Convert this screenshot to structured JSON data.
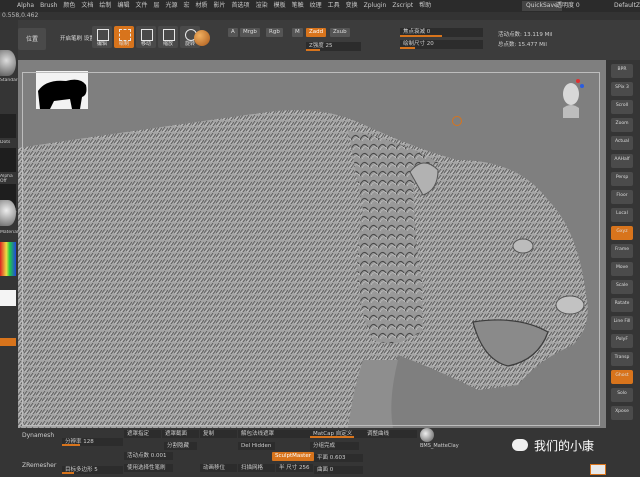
{
  "menu": {
    "items": [
      "Alpha",
      "Brush",
      "颜色",
      "文档",
      "绘制",
      "编辑",
      "文件",
      "层",
      "光源",
      "宏",
      "材质",
      "影片",
      "首选项",
      "渲染",
      "模板",
      "笔触",
      "纹理",
      "工具",
      "变换",
      "Zplugin",
      "Zscript",
      "帮助"
    ],
    "quicksave": "QuickSave",
    "see_through": "透明度 0",
    "default_script": "DefaultZS"
  },
  "title_row": {
    "text": "0.558,0.462"
  },
  "shelf": {
    "left_label": "位置",
    "mode_label": "开启笔刷 设置",
    "tools": [
      {
        "label": "编辑"
      },
      {
        "label": "绘制"
      },
      {
        "label": "移动"
      },
      {
        "label": "缩放"
      },
      {
        "label": "旋转"
      }
    ],
    "channels": {
      "a": "A",
      "mrgb": "Mrgb",
      "rgb": "Rgb",
      "m": "M"
    },
    "zadd": "Zadd",
    "zsub": "Zsub",
    "z_intensity": "Z强度 25",
    "focal_shift": "焦点衰减 0",
    "draw_size": "绘制尺寸 20",
    "active_points": "活动点数: 13.119 Mil",
    "total_points": "总点数: 15.477 Mil"
  },
  "left_tray": {
    "labels": [
      "Standard",
      "Dots",
      "Alpha Off",
      "Texture Off",
      "Material"
    ]
  },
  "right_tray": {
    "buttons": [
      "BPR",
      "SPix 3",
      "Scroll",
      "Zoom",
      "Actual",
      "AAHalf",
      "Persp",
      "Floor",
      "Local",
      "Gxyz",
      "Frame",
      "Move",
      "Scale",
      "Rotate",
      "Line Fill",
      "PolyF",
      "Transp",
      "Ghost",
      "Solo",
      "Xpose"
    ]
  },
  "bottom": {
    "row1": [
      "Dynamesh",
      "分辨率 128",
      "遮罩指定",
      "遮罩截面",
      "复制",
      "解包法线遮罩",
      "MatCap 自定义",
      "BMS_MatteClay"
    ],
    "row2": [
      "ZRemesher",
      "目标多边形 5",
      "活动点数 0.001",
      "使用选择性笔刷",
      "动画移位",
      "扫描网格",
      "半 尺寸 256",
      "SculptMaster"
    ],
    "row3": [
      "分割隐藏",
      "Del Hidden",
      "分组完成",
      "平面 0.603",
      "调整曲线",
      "曲面 0"
    ]
  },
  "watermark": {
    "text": "我们的小康"
  }
}
